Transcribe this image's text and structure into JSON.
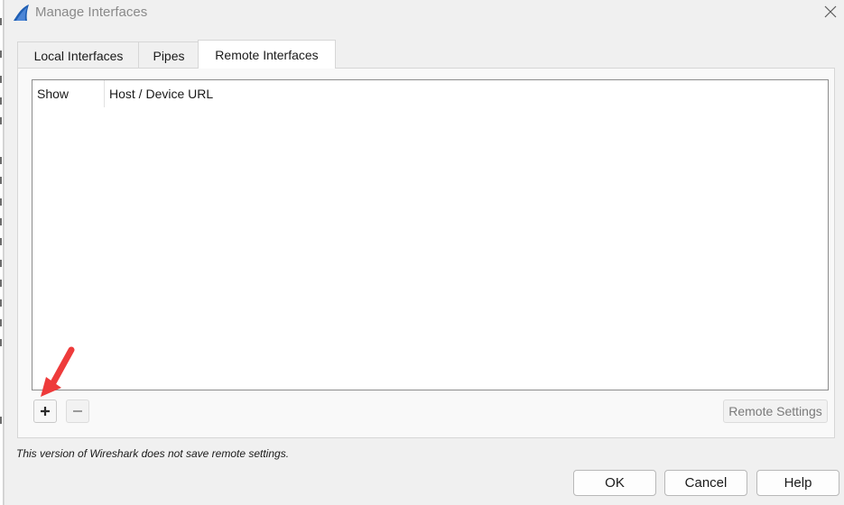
{
  "window": {
    "title": "Manage Interfaces",
    "icon": "wireshark-fin-icon",
    "close_icon": "close-icon"
  },
  "tabs": [
    {
      "label": "Local Interfaces",
      "active": false
    },
    {
      "label": "Pipes",
      "active": false
    },
    {
      "label": "Remote Interfaces",
      "active": true
    }
  ],
  "table": {
    "columns": [
      "Show",
      "Host / Device URL"
    ],
    "rows": []
  },
  "controls": {
    "add_icon": "plus-icon",
    "remove_icon": "minus-icon",
    "remote_settings_label": "Remote Settings"
  },
  "note": "This version of Wireshark does not save remote settings.",
  "buttons": {
    "ok": "OK",
    "cancel": "Cancel",
    "help": "Help"
  },
  "colors": {
    "accent_arrow": "#ee3b3b",
    "icon_blue": "#1f5fb4"
  }
}
